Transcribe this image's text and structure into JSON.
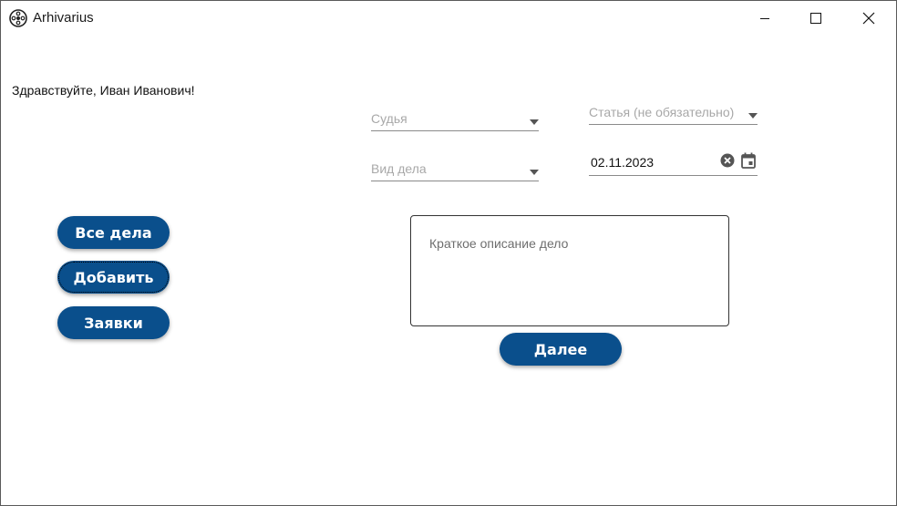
{
  "window": {
    "title": "Arhivarius",
    "icon": "film-reel-icon"
  },
  "greeting": "Здравствуйте, Иван Иванович!",
  "nav": {
    "all_cases": "Все дела",
    "add": "Добавить",
    "requests": "Заявки"
  },
  "form": {
    "judge_placeholder": "Судья",
    "article_placeholder": "Статья (не обязательно)",
    "case_type_placeholder": "Вид дела",
    "date_value": "02.11.2023",
    "description_placeholder": "Краткое описание дело",
    "next_label": "Далее"
  },
  "colors": {
    "accent": "#0a4f8c",
    "placeholder": "#a8a8a8",
    "underline": "#8a8a8a"
  }
}
